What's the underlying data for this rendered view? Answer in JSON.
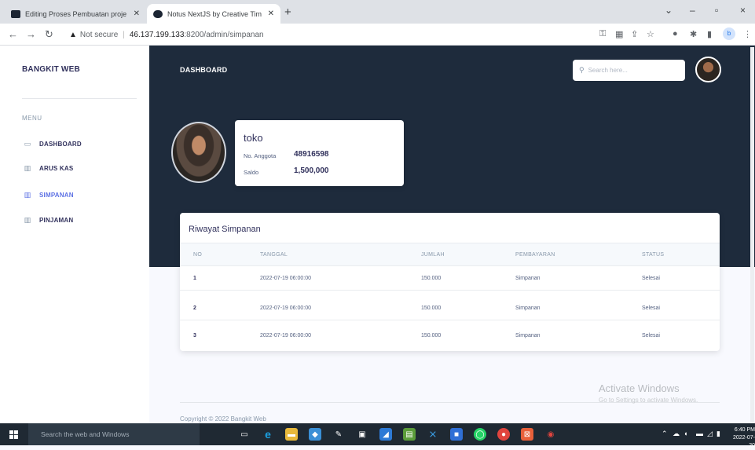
{
  "browser": {
    "tabs": [
      {
        "title": "Editing Proses Pembuatan proje",
        "active": false
      },
      {
        "title": "Notus NextJS by Creative Tim",
        "active": true
      }
    ],
    "new_tab": "+",
    "address": {
      "security": "Not secure",
      "host": "46.137.199.133",
      "path": ":8200/admin/simpanan"
    },
    "window_controls": {
      "chevron": "⌄",
      "minimize": "–",
      "maximize": "▫",
      "close": "×"
    }
  },
  "sidebar": {
    "brand": "BANGKIT WEB",
    "menu_heading": "MENU",
    "items": [
      {
        "label": "DASHBOARD",
        "icon": "monitor-icon",
        "glyph": "▭",
        "active": false
      },
      {
        "label": "ARUS KAS",
        "icon": "bar-chart-icon",
        "glyph": "▥",
        "active": false
      },
      {
        "label": "SIMPANAN",
        "icon": "bar-chart-icon",
        "glyph": "▥",
        "active": true
      },
      {
        "label": "PINJAMAN",
        "icon": "bar-chart-icon",
        "glyph": "▥",
        "active": false
      }
    ]
  },
  "header": {
    "title": "DASHBOARD",
    "search_placeholder": "Search here..."
  },
  "profile": {
    "name": "toko",
    "member_label": "No. Anggota",
    "member_number": "48916598",
    "balance_label": "Saldo",
    "balance": "1,500,000"
  },
  "history": {
    "title": "Riwayat Simpanan",
    "columns": [
      "NO",
      "TANGGAL",
      "JUMLAH",
      "PEMBAYARAN",
      "STATUS"
    ],
    "rows": [
      {
        "no": "1",
        "tanggal": "2022-07-19 06:00:00",
        "jumlah": "150.000",
        "pembayaran": "Simpanan",
        "status": "Selesai"
      },
      {
        "no": "2",
        "tanggal": "2022-07-19 06:00:00",
        "jumlah": "150.000",
        "pembayaran": "Simpanan",
        "status": "Selesai"
      },
      {
        "no": "3",
        "tanggal": "2022-07-19 06:00:00",
        "jumlah": "150.000",
        "pembayaran": "Simpanan",
        "status": "Selesai"
      }
    ]
  },
  "footer": {
    "copyright": "Copyright © 2022 Bangkit Web"
  },
  "watermark": {
    "line1": "Activate Windows",
    "line2": "Go to Settings to activate Windows."
  },
  "taskbar": {
    "search_placeholder": "Search the web and Windows",
    "time": "6:40 PM",
    "date": "2022-07-20"
  },
  "colors": {
    "header_bg": "#1e2b3c",
    "accent": "#5e72e4",
    "text_dark": "#32325d"
  }
}
